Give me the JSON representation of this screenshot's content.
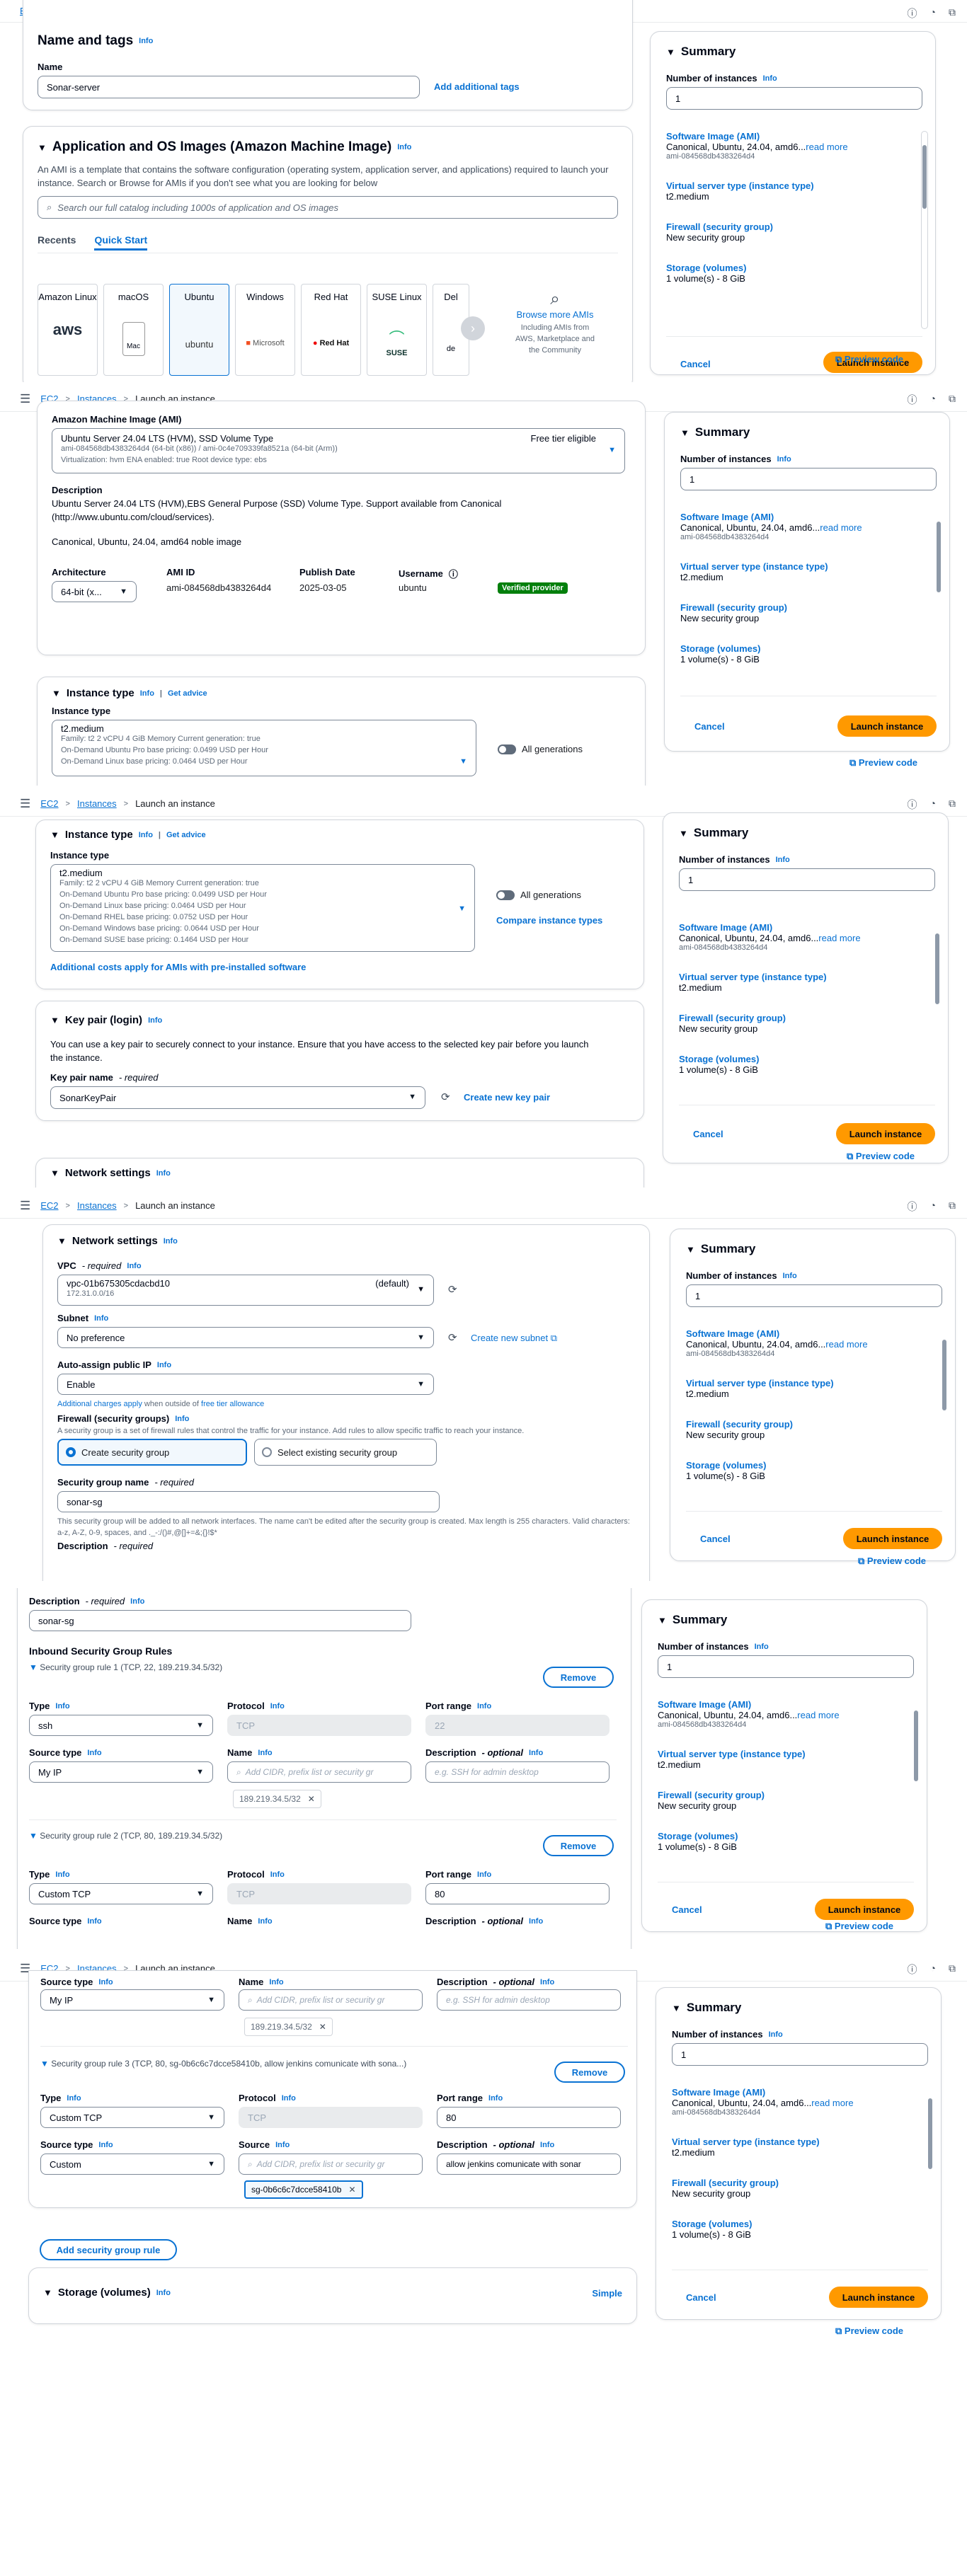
{
  "breadcrumb": {
    "root": "EC2",
    "middle": "Instances",
    "current": "Launch an instance"
  },
  "common": {
    "info": "Info",
    "required": "required"
  },
  "summary": {
    "title": "Summary",
    "num_label": "Number of instances",
    "num_value": "1",
    "ami_title": "Software Image (AMI)",
    "ami_value": "Canonical, Ubuntu, 24.04, amd6...",
    "read_more": "read more",
    "ami_id": "ami-084568db4383264d4",
    "type_title": "Virtual server type (instance type)",
    "type_value": "t2.medium",
    "fw_title": "Firewall (security group)",
    "fw_value": "New security group",
    "storage_title": "Storage (volumes)",
    "storage_value": "1 volume(s) - 8 GiB",
    "cancel": "Cancel",
    "launch": "Launch instance",
    "preview": "Preview code"
  },
  "s1": {
    "name_tags_title": "Name and tags",
    "name_label": "Name",
    "name_value": "Sonar-server",
    "add_tags": "Add additional tags",
    "ami_title": "Application and OS Images (Amazon Machine Image)",
    "ami_desc": "An AMI is a template that contains the software configuration (operating system, application server, and applications) required to launch your instance. Search or Browse for AMIs if you don't see what you are looking for below",
    "search_placeholder": "Search our full catalog including 1000s of application and OS images",
    "tab_recents": "Recents",
    "tab_quick": "Quick Start",
    "tiles": [
      {
        "name": "Amazon Linux",
        "logo": "aws"
      },
      {
        "name": "macOS",
        "logo": "Mac"
      },
      {
        "name": "Ubuntu",
        "logo": "ubuntu"
      },
      {
        "name": "Windows",
        "logo": "Microsoft"
      },
      {
        "name": "Red Hat",
        "logo": "Red Hat"
      },
      {
        "name": "SUSE Linux",
        "logo": "SUSE"
      },
      {
        "name": "Del",
        "logo": "de"
      }
    ],
    "browse_more": "Browse more AMIs",
    "browse_desc": "Including AMIs from AWS, Marketplace and the Community"
  },
  "s2": {
    "ami_label": "Amazon Machine Image (AMI)",
    "ami_name": "Ubuntu Server 24.04 LTS (HVM), SSD Volume Type",
    "ami_line2": "ami-084568db4383264d4 (64-bit (x86)) / ami-0c4e709339fa8521a (64-bit (Arm))",
    "ami_line3": "Virtualization: hvm     ENA enabled: true     Root device type: ebs",
    "free_tier": "Free tier eligible",
    "desc_label": "Description",
    "desc_text": "Ubuntu Server 24.04 LTS (HVM),EBS General Purpose (SSD) Volume Type. Support available from Canonical (http://www.ubuntu.com/cloud/services).",
    "desc_text2": "Canonical, Ubuntu, 24.04, amd64 noble image",
    "arch_label": "Architecture",
    "arch_value": "64-bit (x...",
    "ami_id_label": "AMI ID",
    "ami_id_value": "ami-084568db4383264d4",
    "pub_label": "Publish Date",
    "pub_value": "2025-03-05",
    "user_label": "Username",
    "user_value": "ubuntu",
    "verified": "Verified provider",
    "itype_title": "Instance type",
    "get_advice": "Get advice",
    "itype_label": "Instance type",
    "itype_value": "t2.medium",
    "itype_l1": "Family: t2     2 vCPU     4 GiB Memory     Current generation: true",
    "itype_l2": "On-Demand Ubuntu Pro base pricing: 0.0499 USD per Hour",
    "itype_l3": "On-Demand Linux base pricing: 0.0464 USD per Hour",
    "all_gen": "All generations"
  },
  "s3": {
    "itype_l4": "On-Demand RHEL base pricing: 0.0752 USD per Hour",
    "itype_l5": "On-Demand Windows base pricing: 0.0644 USD per Hour",
    "itype_l6": "On-Demand SUSE base pricing: 0.1464 USD per Hour",
    "compare": "Compare instance types",
    "additional_costs": "Additional costs apply for AMIs with pre-installed software",
    "key_title": "Key pair (login)",
    "key_desc": "You can use a key pair to securely connect to your instance. Ensure that you have access to the selected key pair before you launch the instance.",
    "key_label": "Key pair name",
    "key_value": "SonarKeyPair",
    "create_key": "Create new key pair",
    "net_title": "Network settings"
  },
  "s4": {
    "vpc_label": "VPC",
    "vpc_value": "vpc-01b675305cdacbd10",
    "vpc_cidr": "172.31.0.0/16",
    "vpc_default": "(default)",
    "subnet_label": "Subnet",
    "subnet_value": "No preference",
    "create_subnet": "Create new subnet",
    "auto_ip_label": "Auto-assign public IP",
    "auto_ip_value": "Enable",
    "charges": "Additional charges apply",
    "charges_rest": " when outside of ",
    "free_tier_limit": "free tier allowance",
    "fw_label": "Firewall (security groups)",
    "fw_desc": "A security group is a set of firewall rules that control the traffic for your instance. Add rules to allow specific traffic to reach your instance.",
    "create_sg": "Create security group",
    "select_sg": "Select existing security group",
    "sg_name_label": "Security group name",
    "sg_name_value": "sonar-sg",
    "sg_name_hint": "This security group will be added to all network interfaces. The name can't be edited after the security group is created. Max length is 255 characters. Valid characters: a-z, A-Z, 0-9, spaces, and ._-:/()#,@[]+=&;{}!$*",
    "desc_label": "Description"
  },
  "s5": {
    "desc_label": "Description",
    "desc_value": "sonar-sg",
    "inbound_title": "Inbound Security Group Rules",
    "rule1": "Security group rule 1 (TCP, 22, 189.219.34.5/32)",
    "rule2": "Security group rule 2 (TCP, 80, 189.219.34.5/32)",
    "remove": "Remove",
    "type_label": "Type",
    "protocol_label": "Protocol",
    "port_label": "Port range",
    "source_type_label": "Source type",
    "name_label": "Name",
    "desc_opt_label": "Description",
    "optional": "optional",
    "r1_type": "ssh",
    "r1_proto": "TCP",
    "r1_port": "22",
    "r1_source_type": "My IP",
    "cidr_placeholder": "Add CIDR, prefix list or security gr",
    "r1_desc_placeholder": "e.g. SSH for admin desktop",
    "r1_token": "189.219.34.5/32",
    "r2_type": "Custom TCP",
    "r2_proto": "TCP",
    "r2_port": "80"
  },
  "s6": {
    "source_type_label": "Source type",
    "name_label": "Name",
    "desc_opt_label": "Description",
    "optional": "optional",
    "r2_source_type": "My IP",
    "cidr_placeholder": "Add CIDR, prefix list or security gr",
    "desc_placeholder": "e.g. SSH for admin desktop",
    "r2_token": "189.219.34.5/32",
    "rule3": "Security group rule 3 (TCP, 80, sg-0b6c6c7dcce58410b, allow jenkins comunicate with sona...)",
    "remove": "Remove",
    "type_label": "Type",
    "protocol_label": "Protocol",
    "port_label": "Port range",
    "r3_type": "Custom TCP",
    "r3_proto": "TCP",
    "r3_port": "80",
    "source_label": "Source",
    "r3_source_type": "Custom",
    "r3_desc": "allow jenkins comunicate with sonar",
    "r3_token": "sg-0b6c6c7dcce58410b",
    "add_rule": "Add security group rule",
    "storage_title": "Storage (volumes)",
    "simple": "Simple"
  }
}
